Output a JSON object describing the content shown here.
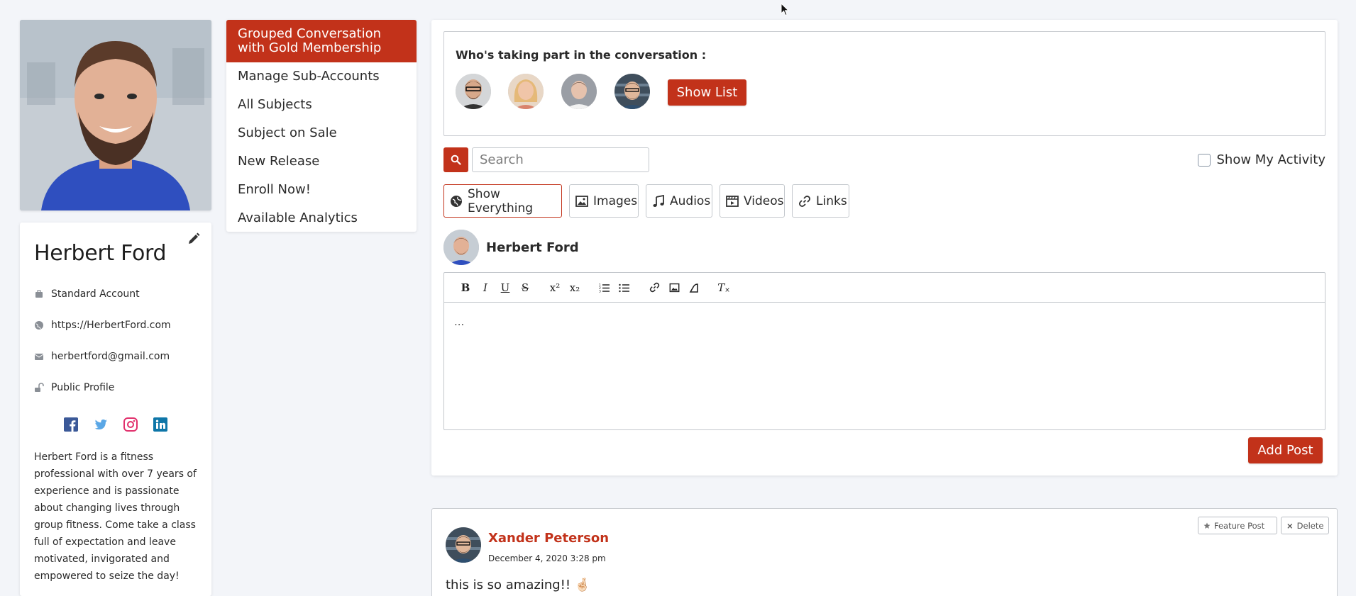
{
  "profile": {
    "name": "Herbert Ford",
    "account_type": "Standard Account",
    "website": "https://HerbertFord.com",
    "email": "herbertford@gmail.com",
    "visibility": "Public Profile",
    "bio": "Herbert Ford is a fitness professional with over 7 years of experience and is passionate about changing lives through group fitness. Come take a class full of expectation and leave motivated, invigorated and empowered to seize the day!",
    "socials": [
      "facebook-icon",
      "twitter-icon",
      "instagram-icon",
      "linkedin-icon"
    ]
  },
  "nav": {
    "items": [
      {
        "label": "Grouped Conversation with Gold Membership",
        "active": true
      },
      {
        "label": "Manage Sub-Accounts"
      },
      {
        "label": "All Subjects"
      },
      {
        "label": "Subject on Sale"
      },
      {
        "label": "New Release"
      },
      {
        "label": "Enroll Now!"
      },
      {
        "label": "Available Analytics"
      }
    ]
  },
  "participants": {
    "title": "Who's taking part in the conversation :",
    "show_list_label": "Show List"
  },
  "search": {
    "placeholder": "Search",
    "value": ""
  },
  "activity": {
    "label": "Show My Activity",
    "checked": false
  },
  "filters": [
    {
      "label": "Show Everything",
      "icon": "globe-icon",
      "active": true
    },
    {
      "label": "Images",
      "icon": "image-icon"
    },
    {
      "label": "Audios",
      "icon": "music-icon"
    },
    {
      "label": "Videos",
      "icon": "film-icon"
    },
    {
      "label": "Links",
      "icon": "link-icon"
    }
  ],
  "composer": {
    "author": "Herbert Ford",
    "body_text": "...",
    "submit_label": "Add Post"
  },
  "post": {
    "author": "Xander Peterson",
    "date": "December 4, 2020 3:28 pm",
    "text": "this is so amazing!! 🤞🏻",
    "feature_label": "Feature Post",
    "delete_label": "Delete"
  },
  "colors": {
    "accent": "#c2321a",
    "background": "#f3f5f9",
    "card": "#ffffff",
    "border": "#c3c7cc"
  }
}
